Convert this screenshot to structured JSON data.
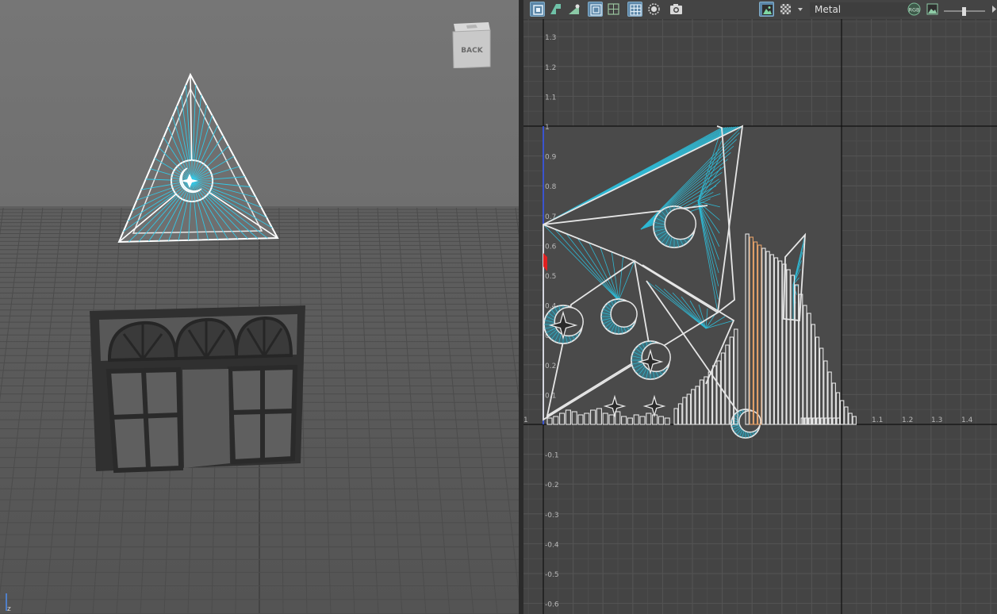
{
  "viewport3d": {
    "view_cube_label": "BACK",
    "axis_indicator_label": "z"
  },
  "uv_editor": {
    "toolbar": {
      "buttons": [
        {
          "icon": "uv-shell-select-icon",
          "active": true
        },
        {
          "icon": "uv-face-select-icon",
          "active": false
        },
        {
          "icon": "uv-vertex-select-icon",
          "active": false
        },
        {
          "icon": "display-wireframe-icon",
          "active": true
        },
        {
          "icon": "display-grid-icon",
          "active": false
        },
        {
          "icon": "uv-checker-grid-icon",
          "active": true
        },
        {
          "icon": "isolate-select-icon",
          "active": false
        },
        {
          "icon": "snapshot-camera-icon",
          "active": false
        },
        {
          "icon": "image-display-icon",
          "active": true
        },
        {
          "icon": "checker-pattern-icon",
          "active": false
        },
        {
          "icon": "dropdown-arrow-icon",
          "active": false
        },
        {
          "icon": "rgb-channels-icon",
          "active": false
        },
        {
          "icon": "image-view-icon",
          "active": false
        },
        {
          "icon": "exposure-slider-icon",
          "active": false
        }
      ],
      "texture_name": "Metal",
      "rgb_label": "RGB"
    },
    "grid": {
      "v_tick_labels": [
        "1.3",
        "1.2",
        "1.1",
        "1",
        "0.9",
        "0.8",
        "0.7",
        "0.6",
        "0.5",
        "0.4",
        "0.3",
        "0.2",
        "0.1",
        "-0.1",
        "-0.2",
        "-0.3",
        "-0.4",
        "-0.5",
        "-0.6"
      ],
      "u_tick_labels": [
        "1",
        "1.1",
        "1.2",
        "1.3",
        "1.4",
        "1"
      ]
    }
  }
}
